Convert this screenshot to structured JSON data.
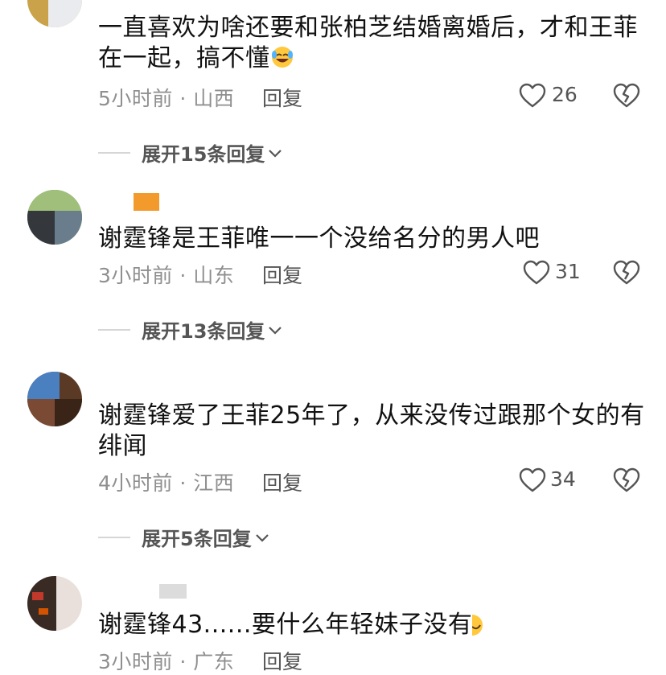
{
  "comments": [
    {
      "text": "一直喜欢为啥还要和张柏芝结婚离婚后，才和王菲在一起，搞不懂",
      "emoji": "rofl-emoji",
      "time": "5小时前 · 山西",
      "reply_label": "回复",
      "likes": "26",
      "expand_label": "展开15条回复"
    },
    {
      "text": "谢霆锋是王菲唯一一个没给名分的男人吧",
      "time": "3小时前 · 山东",
      "reply_label": "回复",
      "likes": "31",
      "expand_label": "展开13条回复"
    },
    {
      "text": "谢霆锋爱了王菲25年了，从来没传过跟那个女的有绯闻",
      "time": "4小时前 · 江西",
      "reply_label": "回复",
      "likes": "34",
      "expand_label": "展开5条回复"
    },
    {
      "text": "谢霆锋43......要什么年轻妹子没有",
      "emoji": "grin-emoji",
      "time": "3小时前 · 广东",
      "reply_label": "回复"
    }
  ],
  "colors": {
    "meta": "#8f8f8f",
    "accent_badge": "#f39a2c",
    "icon_stroke": "#555555"
  }
}
